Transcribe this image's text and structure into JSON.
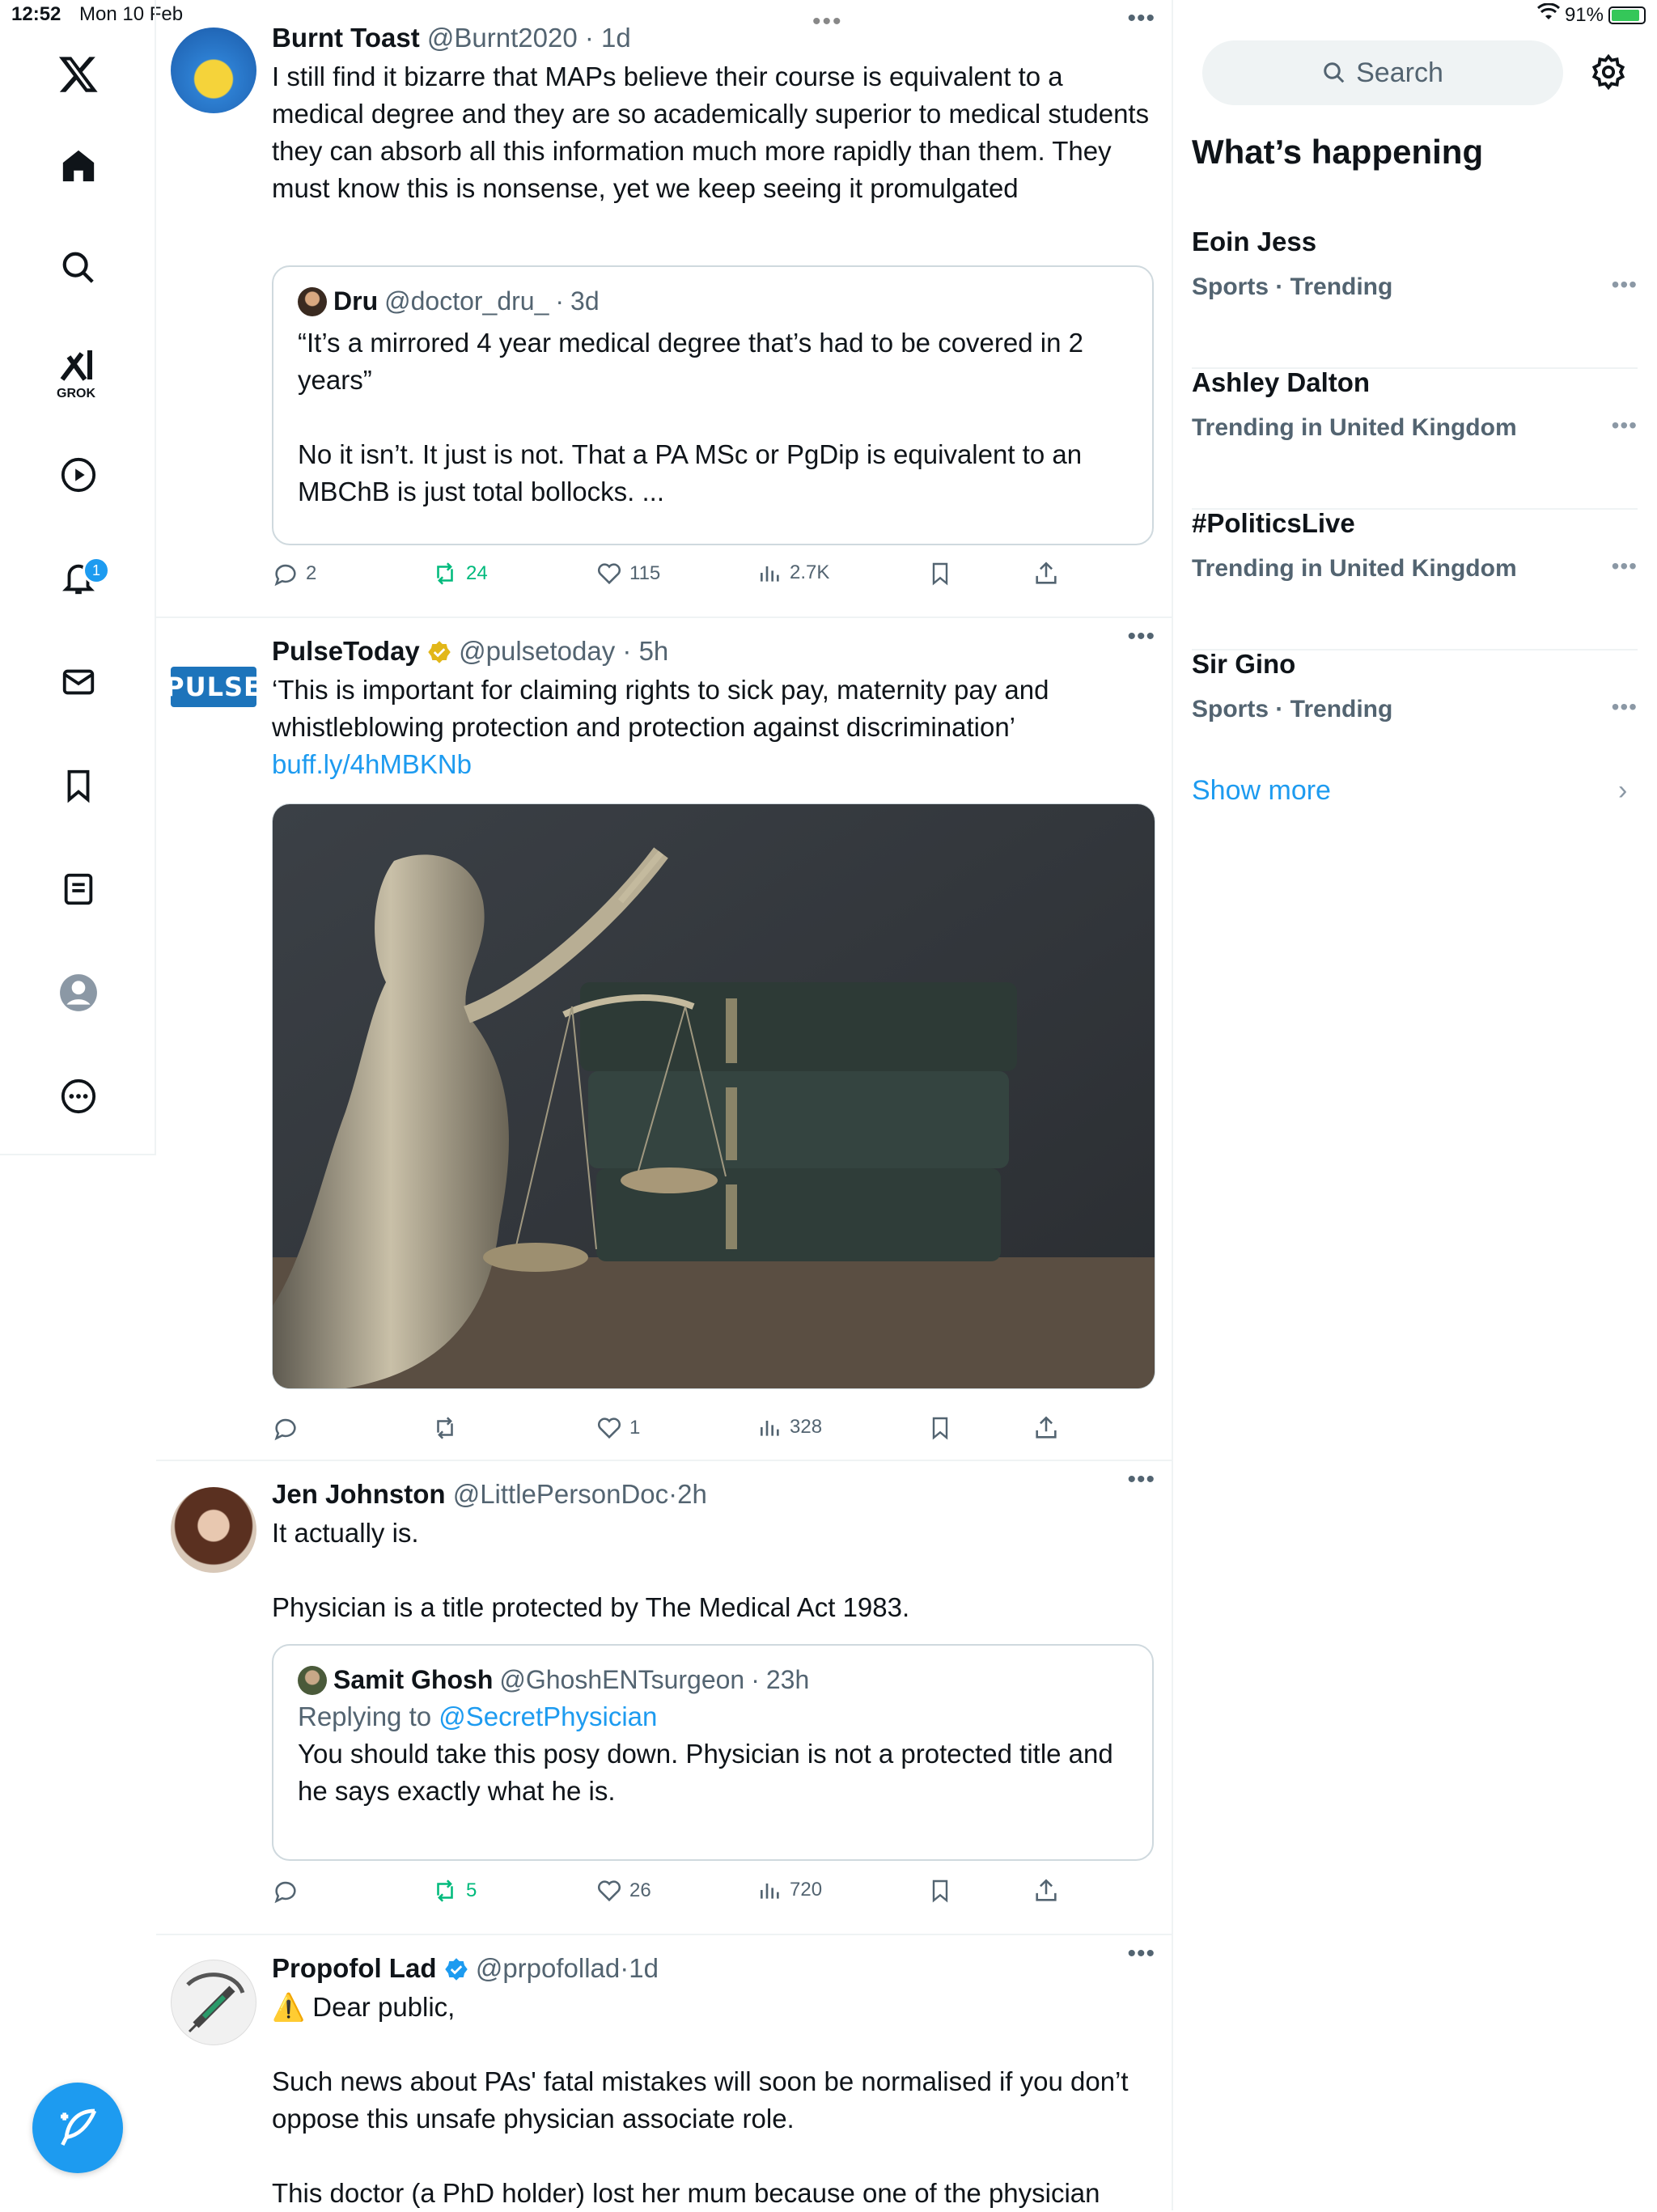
{
  "status_bar": {
    "time": "12:52",
    "date": "Mon 10 Feb",
    "battery": "91%",
    "battery_level": 0.91
  },
  "nav": {
    "grok_label": "GROK",
    "notifications_badge": "1",
    "items": [
      "x-logo",
      "home",
      "explore",
      "grok",
      "video",
      "notifications",
      "messages",
      "bookmarks",
      "lists",
      "profile",
      "more"
    ]
  },
  "posts": [
    {
      "name": "Burnt Toast",
      "handle": "@Burnt2020",
      "time": "1d",
      "text": "I still find it bizarre that MAPs believe their course is equivalent to a medical degree and they are so academically superior to medical students they can absorb all this information much more rapidly than them. They must know this is nonsense, yet we keep seeing it promulgated",
      "quote": {
        "name": "Dru",
        "handle": "@doctor_dru_",
        "time": "3d",
        "text": "“It’s a mirrored 4 year medical degree that’s had to be covered in 2 years”\n\nNo it isn’t. It just is not. That a PA MSc or PgDip is equivalent to an MBChB is just total bollocks. ..."
      },
      "stats": {
        "replies": "2",
        "reposts": "24",
        "likes": "115",
        "views": "2.7K"
      }
    },
    {
      "name": "PulseToday",
      "handle": "@pulsetoday",
      "time": "5h",
      "avatar_text": "PULSE",
      "text": "‘This is important for claiming rights to sick pay, maternity pay and whistleblowing protection and protection against discrimination’",
      "link": "buff.ly/4hMBKNb",
      "stats": {
        "replies": "",
        "reposts": "",
        "likes": "1",
        "views": "328"
      }
    },
    {
      "name": "Jen Johnston",
      "handle": "@LittlePersonDoc",
      "time": "2h",
      "text": "It actually is.\n\nPhysician is a title protected by The Medical Act 1983.",
      "quote": {
        "name": "Samit Ghosh",
        "handle": "@GhoshENTsurgeon",
        "time": "23h",
        "reply_label": "Replying to",
        "reply_handle": "@SecretPhysician",
        "text": "You should take this posy down. Physician is not a protected title and he says exactly what he is."
      },
      "stats": {
        "replies": "",
        "reposts": "5",
        "likes": "26",
        "views": "720"
      }
    },
    {
      "name": "Propofol Lad",
      "handle": "@prpofollad",
      "time": "1d",
      "warning": "⚠️",
      "text": "Dear public,\n\nSuch news about PAs' fatal mistakes will soon be normalised if you don’t oppose this unsafe physician associate role.\n\nThis doctor (a PhD holder) lost her mum because one of the physician"
    }
  ],
  "sidebar": {
    "search_placeholder": "Search",
    "title": "What’s happening",
    "trends": [
      {
        "title": "Eoin Jess",
        "meta": "Sports · Trending"
      },
      {
        "title": "Ashley Dalton",
        "meta": "Trending in United Kingdom"
      },
      {
        "title": "#PoliticsLive",
        "meta": "Trending in United Kingdom"
      },
      {
        "title": "Sir Gino",
        "meta": "Sports · Trending"
      }
    ],
    "show_more": "Show more"
  },
  "colors": {
    "accent": "#1d9bf0",
    "repost_green": "#00ba7c",
    "verified_gold": "#e2b719",
    "muted": "#536471"
  }
}
